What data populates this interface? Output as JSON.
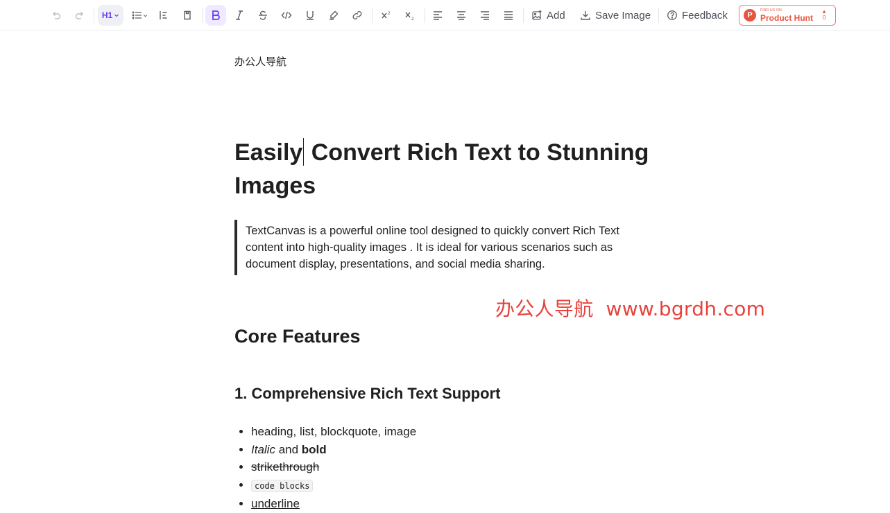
{
  "toolbar": {
    "heading_label": "H1",
    "add_label": "Add",
    "save_label": "Save Image",
    "feedback_label": "Feedback",
    "product_hunt": {
      "small": "FIND US ON",
      "big": "Product Hunt",
      "logo": "P",
      "count": "0"
    }
  },
  "doc": {
    "site_label": "办公人导航",
    "title_part1": "Easily",
    "title_part2": " Convert Rich Text to Stunning Images",
    "quote": "TextCanvas is a powerful online tool designed to quickly convert Rich Text content into high-quality images . It is ideal for various scenarios such as document display, presentations, and social media sharing.",
    "core_heading": "Core Features",
    "sub_heading": "1. Comprehensive Rich Text Support",
    "list": {
      "item1": "heading, list, blockquote, image",
      "italic": "Italic",
      "and": " and ",
      "bold": "bold",
      "strike": "strikethrough",
      "code": "code blocks",
      "underline": "underline"
    }
  },
  "watermark": {
    "name": "办公人导航",
    "url": "www.bgrdh.com"
  },
  "colors": {
    "accent": "#6a3df0",
    "watermark": "#e8413c",
    "product_hunt": "#e8553f"
  }
}
